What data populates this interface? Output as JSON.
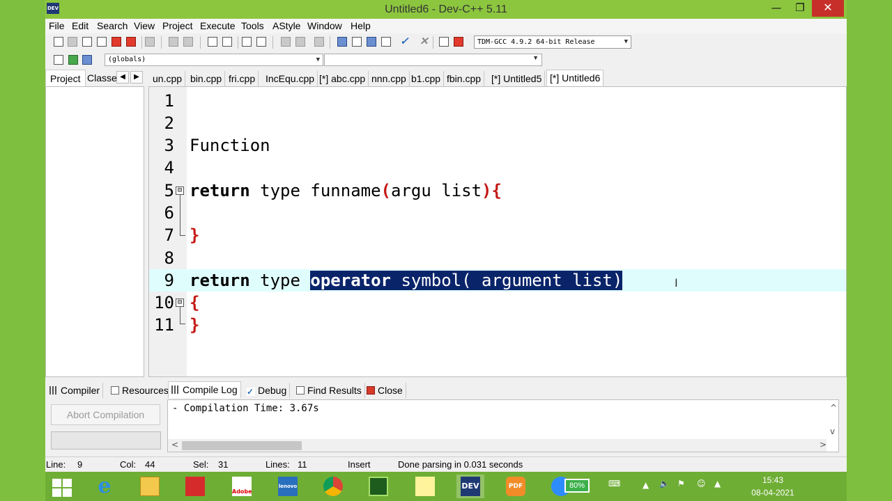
{
  "window": {
    "title": "Untitled6 - Dev-C++ 5.11",
    "app_icon_label": "DEV",
    "controls": {
      "minimize": "—",
      "maximize": "❐",
      "close": "✕"
    }
  },
  "menu": [
    "File",
    "Edit",
    "Search",
    "View",
    "Project",
    "Execute",
    "Tools",
    "AStyle",
    "Window",
    "Help"
  ],
  "toolbar": {
    "compiler_select": "TDM-GCC 4.9.2 64-bit Release",
    "scope_select": "(globals)",
    "function_select": ""
  },
  "left_panel": {
    "tabs": [
      "Project",
      "Classes"
    ],
    "active_tab": "Project",
    "nav_prev": "◀",
    "nav_next": "▶"
  },
  "editor_tabs": [
    "un.cpp",
    "bin.cpp",
    "fri.cpp",
    "IncEqu.cpp",
    "[*] abc.cpp",
    "nnn.cpp",
    "b1.cpp",
    "fbin.cpp",
    "[*] Untitled5",
    "[*] Untitled6"
  ],
  "active_editor_tab": "[*] Untitled6",
  "editor": {
    "line_numbers": [
      "1",
      "2",
      "3",
      "4",
      "5",
      "6",
      "7",
      "8",
      "9",
      "10",
      "11"
    ],
    "current_line": "9",
    "fold_markers": [
      "⊟",
      "⊟"
    ],
    "lines": {
      "l3": "Function",
      "l5_kw": "return",
      "l5_text": " type funname",
      "l5_open": "(",
      "l5_mid": "argu list",
      "l5_close": "){",
      "l7": "}",
      "l9_kw": "return",
      "l9_text": " type ",
      "l9_sel_kw": "operator",
      "l9_sel_text": " symbol( argument list)",
      "l10": "{",
      "l11": "}"
    },
    "mouse_cursor": "I"
  },
  "bottom_tabs": [
    "Compiler",
    "Resources",
    "Compile Log",
    "Debug",
    "Find Results",
    "Close"
  ],
  "active_bottom_tab": "Compile Log",
  "compile_log": {
    "abort_button": "Abort Compilation",
    "text": "- Compilation Time: 3.67s",
    "scroll_left": "<",
    "scroll_right": ">",
    "scroll_up": "^",
    "scroll_down": "v"
  },
  "status": {
    "line_label": "Line:",
    "line_value": "9",
    "col_label": "Col:",
    "col_value": "44",
    "sel_label": "Sel:",
    "sel_value": "31",
    "lines_label": "Lines:",
    "lines_value": "11",
    "mode": "Insert",
    "message": "Done parsing in 0.031 seconds"
  },
  "taskbar": {
    "apps": [
      "windows-start",
      "internet-explorer",
      "file-explorer",
      "3d-app",
      "adobe",
      "lenovo",
      "chrome",
      "console-app",
      "sticky-notes",
      "dev-cpp",
      "pdf-app",
      "zoom"
    ],
    "adobe_label": "Adobe",
    "lenovo_label": "lenovo",
    "dev_label": "DEV",
    "pdf_label": "PDF",
    "battery": "80%",
    "time": "15:43",
    "date": "08-04-2021"
  },
  "colors": {
    "titlebar": "#8cc63f",
    "taskbar": "#6fae35",
    "selection": "#0a246a",
    "current_line": "#e0fdfd",
    "brace": "#c41a16"
  }
}
